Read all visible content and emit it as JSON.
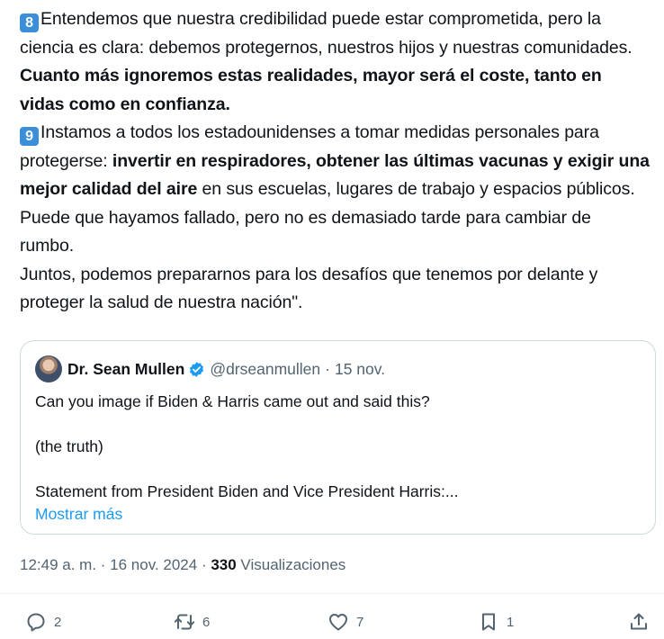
{
  "tweet": {
    "p8_emoji": "8",
    "p8_normal": "Entendemos que nuestra credibilidad puede estar comprometida, pero la ciencia es clara: debemos protegernos, nuestros hijos y nuestras comunidades. ",
    "p8_bold": "Cuanto más ignoremos estas realidades, mayor será el coste, tanto en vidas como en confianza.",
    "p9_emoji": "9",
    "p9_normal_a": "Instamos a todos los estadounidenses a tomar medidas personales para protegerse: ",
    "p9_bold": "invertir en respiradores, obtener las últimas vacunas y exigir una mejor calidad del aire",
    "p9_normal_b": " en sus escuelas, lugares de trabajo y espacios públicos.",
    "p10": "Puede que hayamos fallado, pero no es demasiado tarde para cambiar de rumbo.",
    "p11": "Juntos, podemos prepararnos para los desafíos que tenemos por delante y proteger la salud de nuestra nación\"."
  },
  "quote": {
    "name": "Dr. Sean Mullen",
    "handle": "@drseanmullen",
    "separator": "·",
    "date": "15 nov.",
    "line1": "Can you image if Biden & Harris came out and said this?",
    "line2": "(the truth)",
    "line3": "Statement from President Biden and Vice President Harris:...",
    "show_more": "Mostrar más"
  },
  "meta": {
    "time": "12:49 a. m.",
    "sep1": " · ",
    "date": "16 nov. 2024",
    "sep2": " · ",
    "views": "330",
    "views_label": " Visualizaciones"
  },
  "actions": {
    "replies": "2",
    "reposts": "6",
    "likes": "7",
    "bookmarks": "1"
  },
  "colors": {
    "accent": "#1d9bf0",
    "secondary_text": "#536471",
    "keycap": "#3b8fd9"
  }
}
